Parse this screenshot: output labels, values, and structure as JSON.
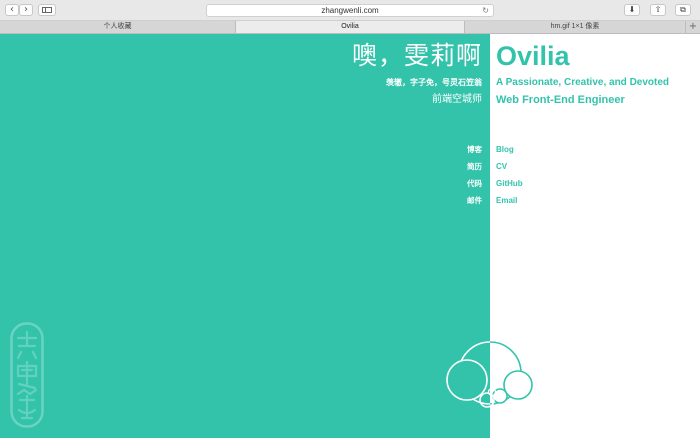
{
  "browser": {
    "url": "zhangwenli.com",
    "tabs": [
      {
        "label": "个人收藏"
      },
      {
        "label": "Ovilia"
      },
      {
        "label": "hm.gif 1×1 像素"
      }
    ],
    "icons": [
      "back-icon",
      "forward-icon",
      "sidebar-icon",
      "reload-icon",
      "download-icon",
      "share-icon",
      "tabs-overview-icon",
      "new-tab-icon"
    ]
  },
  "profile": {
    "cn_name": "噢，雯莉啊",
    "cn_sub": "羡辙，字子免，号灵石笠翁",
    "cn_role": "前端空城师",
    "en_name": "Ovilia",
    "en_tagline": "A Passionate, Creative, and Devoted",
    "en_role": "Web Front-End Engineer"
  },
  "links": [
    {
      "cn": "博客",
      "en": "Blog"
    },
    {
      "cn": "简历",
      "en": "CV"
    },
    {
      "cn": "代码",
      "en": "GitHub"
    },
    {
      "cn": "邮件",
      "en": "Email"
    }
  ],
  "colors": {
    "accent": "#33c3ab",
    "background": "#ffffff"
  }
}
